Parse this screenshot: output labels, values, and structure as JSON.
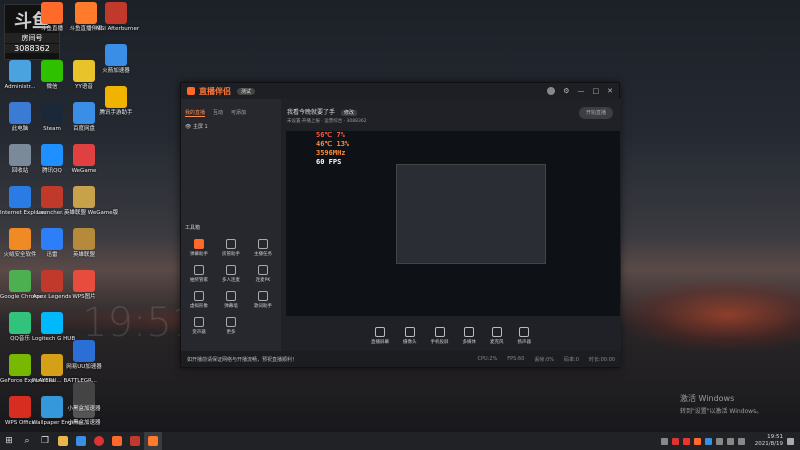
{
  "logo": {
    "line1": "斗鱼",
    "line2": "房间号",
    "line3": "3088362"
  },
  "desktop_icons": [
    {
      "label": "Administr...",
      "color": "#4aa3df",
      "col": 0,
      "row": 0
    },
    {
      "label": "微信",
      "color": "#2dc100",
      "col": 1,
      "row": 0
    },
    {
      "label": "YY语音",
      "color": "#e8c32a",
      "col": 2,
      "row": 0
    },
    {
      "label": "此电脑",
      "color": "#3b7bd4",
      "col": 0,
      "row": 1
    },
    {
      "label": "Steam",
      "color": "#1b2838",
      "col": 1,
      "row": 1
    },
    {
      "label": "百度网盘",
      "color": "#3a8ee6",
      "col": 2,
      "row": 1
    },
    {
      "label": "回收站",
      "color": "#7a8a99",
      "col": 0,
      "row": 2
    },
    {
      "label": "腾讯QQ",
      "color": "#1e90ff",
      "col": 1,
      "row": 2
    },
    {
      "label": "WeGame",
      "color": "#e04040",
      "col": 2,
      "row": 2
    },
    {
      "label": "Internet Explorer",
      "color": "#2a7be4",
      "col": 0,
      "row": 3
    },
    {
      "label": "Launcher...",
      "color": "#c0392b",
      "col": 1,
      "row": 3
    },
    {
      "label": "英雄联盟 WeGame版",
      "color": "#c8a24a",
      "col": 2,
      "row": 3
    },
    {
      "label": "火绒安全软件",
      "color": "#f08a24",
      "col": 0,
      "row": 4
    },
    {
      "label": "迅雷",
      "color": "#2d7ef7",
      "col": 1,
      "row": 4
    },
    {
      "label": "英雄联盟",
      "color": "#b58a3a",
      "col": 2,
      "row": 4
    },
    {
      "label": "Google Chrome",
      "color": "#4caf50",
      "col": 0,
      "row": 5
    },
    {
      "label": "Apex Legends",
      "color": "#c0392b",
      "col": 1,
      "row": 5
    },
    {
      "label": "WPS图片",
      "color": "#e74c3c",
      "col": 2,
      "row": 5
    },
    {
      "label": "QQ音乐",
      "color": "#31c27c",
      "col": 0,
      "row": 6
    },
    {
      "label": "Logitech G HUB",
      "color": "#00b8fc",
      "col": 1,
      "row": 6
    },
    {
      "label": "GeForce Experience",
      "color": "#76b900",
      "col": 0,
      "row": 7
    },
    {
      "label": "PLAYERU... BATTLEGR...",
      "color": "#d4a017",
      "col": 1,
      "row": 7
    },
    {
      "label": "Wallpaper Engine:...",
      "color": "#3498db",
      "col": 1,
      "row": 8
    },
    {
      "label": "WPS Office",
      "color": "#d62d20",
      "col": 0,
      "row": 8
    },
    {
      "label": "小黑盒加速器",
      "color": "#555555",
      "col": 2,
      "row": 8
    }
  ],
  "desktop_icons_extra": [
    {
      "label": "斗鱼直播",
      "color": "#ff6a2a"
    },
    {
      "label": "斗鱼直播伴侣",
      "color": "#ff7a2a"
    },
    {
      "label": "MSI Afterburner",
      "color": "#c0392b"
    },
    {
      "label": "火箭加速器",
      "color": "#3a8ee6"
    },
    {
      "label": "腾讯手游助手",
      "color": "#f0b400"
    },
    {
      "label": "网易UU加速器",
      "color": "#2a6fd6"
    },
    {
      "label": "小黑盒加速器",
      "color": "#444444"
    }
  ],
  "clock_bg": "19:51",
  "app": {
    "title": "直播伴侣",
    "version": "测试",
    "tabs": [
      "我的直播",
      "互动",
      "可添加"
    ],
    "scene": "主屏 1",
    "room_title": "我看今晚就要了手",
    "room_tag": "修改",
    "room_sub": "未设置·开播上报  · 运营综合 · 3088362",
    "tools_header": "工具箱",
    "tools": [
      "弹幕助手",
      "房管助手",
      "主播任务",
      "抽奖管家",
      "多人连麦",
      "连麦PK",
      "虚拟形象",
      "弹幕墙",
      "歌词助手",
      "变声器",
      "更多"
    ],
    "controls": [
      "直播屏幕",
      "摄像头",
      "手机投屏",
      "多媒体",
      "麦克风",
      "扬声器"
    ],
    "start_label": "开始直播",
    "status_text": "如开播前请保证网络与开播流畅，预祝直播顺利！",
    "status_right": [
      "CPU:2%",
      "FPS:60",
      "丢帧:0%",
      "码率:0",
      "时长:00:00"
    ]
  },
  "preview_stats": [
    "56℃  7%",
    "46℃  13%",
    "3596MHz",
    "60 FPS"
  ],
  "activate": {
    "line1": "激活 Windows",
    "line2": "转到\"设置\"以激活 Windows。"
  },
  "taskbar": {
    "time": "19:51",
    "date": "2021/8/19"
  }
}
